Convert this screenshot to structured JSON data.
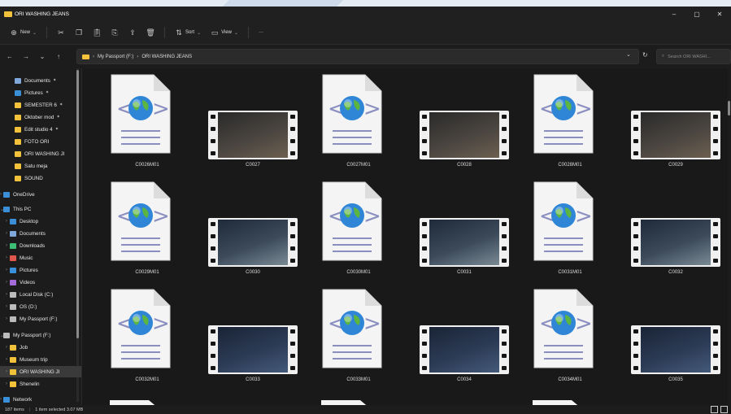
{
  "window": {
    "title": "ORI WASHING JEANS",
    "min_glyph": "–",
    "max_glyph": "▢",
    "close_glyph": "✕"
  },
  "toolbar": {
    "new_label": "New",
    "sort_label": "Sort",
    "view_label": "View",
    "more_label": "···"
  },
  "address": {
    "segment1": "My Passport (F:)",
    "separator": "›",
    "segment2": "ORI WASHING JEANS",
    "search_placeholder": "Search ORI WASHI..."
  },
  "sidebar": {
    "items": [
      {
        "label": "Documents",
        "pinned": true,
        "icon": "documents-icon",
        "color": "#7fa7d9"
      },
      {
        "label": "Pictures",
        "pinned": true,
        "icon": "pictures-icon",
        "color": "#3a8fd6"
      },
      {
        "label": "SEMESTER 6",
        "pinned": true,
        "icon": "folder-icon",
        "color": "#f3c23b"
      },
      {
        "label": "Oktober mod",
        "pinned": true,
        "icon": "folder-icon",
        "color": "#f3c23b"
      },
      {
        "label": "Edit studio 4",
        "pinned": true,
        "icon": "folder-icon",
        "color": "#f3c23b"
      },
      {
        "label": "FOTO ORI",
        "pinned": false,
        "icon": "folder-icon",
        "color": "#f3c23b"
      },
      {
        "label": "ORI WASHING JI",
        "pinned": false,
        "icon": "folder-icon",
        "color": "#f3c23b"
      },
      {
        "label": "Satu meja",
        "pinned": false,
        "icon": "folder-icon",
        "color": "#f3c23b"
      },
      {
        "label": "SOUND",
        "pinned": false,
        "icon": "folder-icon",
        "color": "#f3c23b"
      },
      {
        "label": "OneDrive",
        "pinned": false,
        "icon": "cloud-icon",
        "color": "#3a8fd6"
      },
      {
        "label": "This PC",
        "pinned": false,
        "icon": "pc-icon",
        "color": "#3a8fd6"
      },
      {
        "label": "Desktop",
        "pinned": false,
        "icon": "desktop-icon",
        "color": "#3a8fd6"
      },
      {
        "label": "Documents",
        "pinned": false,
        "icon": "documents-icon",
        "color": "#7fa7d9"
      },
      {
        "label": "Downloads",
        "pinned": false,
        "icon": "download-icon",
        "color": "#3bbf74"
      },
      {
        "label": "Music",
        "pinned": false,
        "icon": "music-icon",
        "color": "#e2574c"
      },
      {
        "label": "Pictures",
        "pinned": false,
        "icon": "pictures-icon",
        "color": "#3a8fd6"
      },
      {
        "label": "Videos",
        "pinned": false,
        "icon": "videos-icon",
        "color": "#a66bd8"
      },
      {
        "label": "Local Disk (C:)",
        "pinned": false,
        "icon": "disk-icon",
        "color": "#bbbbbb"
      },
      {
        "label": "OS (D:)",
        "pinned": false,
        "icon": "disk-icon",
        "color": "#bbbbbb"
      },
      {
        "label": "My Passport (F:)",
        "pinned": false,
        "icon": "disk-icon",
        "color": "#bbbbbb"
      },
      {
        "label": "My Passport (F:)",
        "pinned": false,
        "icon": "disk-icon",
        "color": "#bbbbbb"
      },
      {
        "label": "Job",
        "pinned": false,
        "icon": "folder-icon",
        "color": "#f3c23b"
      },
      {
        "label": "Museum trip",
        "pinned": false,
        "icon": "folder-icon",
        "color": "#f3c23b"
      },
      {
        "label": "ORI WASHING JI",
        "pinned": false,
        "icon": "folder-icon",
        "color": "#f3c23b"
      },
      {
        "label": "Shenelin",
        "pinned": false,
        "icon": "folder-icon",
        "color": "#f3c23b"
      },
      {
        "label": "Network",
        "pinned": false,
        "icon": "network-icon",
        "color": "#3a8fd6"
      }
    ]
  },
  "files": [
    {
      "name": "C0026M01",
      "type": "xml"
    },
    {
      "name": "C0027",
      "type": "video"
    },
    {
      "name": "C0027M01",
      "type": "xml"
    },
    {
      "name": "C0028",
      "type": "video"
    },
    {
      "name": "C0028M01",
      "type": "xml"
    },
    {
      "name": "C0029",
      "type": "video"
    },
    {
      "name": "C0029M01",
      "type": "xml"
    },
    {
      "name": "C0030",
      "type": "video"
    },
    {
      "name": "C0030M01",
      "type": "xml"
    },
    {
      "name": "C0031",
      "type": "video"
    },
    {
      "name": "C0031M01",
      "type": "xml"
    },
    {
      "name": "C0032",
      "type": "video"
    },
    {
      "name": "C0032M01",
      "type": "xml"
    },
    {
      "name": "C0033",
      "type": "video"
    },
    {
      "name": "C0033M01",
      "type": "xml"
    },
    {
      "name": "C0034",
      "type": "video"
    },
    {
      "name": "C0034M01",
      "type": "xml"
    },
    {
      "name": "C0035",
      "type": "video"
    }
  ],
  "status": {
    "items_count": "187 items",
    "selection": "1 item selected  3.07 MB"
  },
  "colors": {
    "folder": "#f3c23b",
    "accent": "#3a8fd6",
    "background": "#191919"
  }
}
